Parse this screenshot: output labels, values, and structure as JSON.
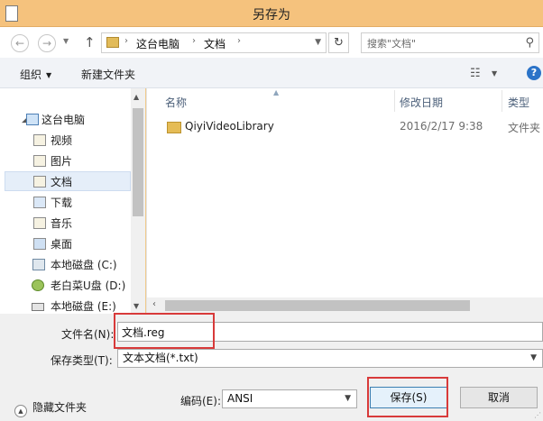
{
  "window": {
    "title": "另存为"
  },
  "address": {
    "crumbs": [
      "这台电脑",
      "文档"
    ],
    "search_placeholder": "搜索\"文档\""
  },
  "toolbar": {
    "organize_label": "组织",
    "new_folder_label": "新建文件夹"
  },
  "nav": {
    "items": [
      {
        "label": "这台电脑",
        "icon": "computer-icon"
      },
      {
        "label": "视频",
        "icon": "video-folder-icon"
      },
      {
        "label": "图片",
        "icon": "pictures-folder-icon"
      },
      {
        "label": "文档",
        "icon": "documents-folder-icon",
        "selected": true
      },
      {
        "label": "下载",
        "icon": "downloads-folder-icon"
      },
      {
        "label": "音乐",
        "icon": "music-folder-icon"
      },
      {
        "label": "桌面",
        "icon": "desktop-folder-icon"
      },
      {
        "label": "本地磁盘 (C:)",
        "icon": "drive-icon"
      },
      {
        "label": "老白菜U盘 (D:)",
        "icon": "usb-drive-icon"
      },
      {
        "label": "本地磁盘 (E:)",
        "icon": "drive-icon"
      }
    ]
  },
  "file_list": {
    "columns": [
      "名称",
      "修改日期",
      "类型"
    ],
    "rows": [
      {
        "name": "QiyiVideoLibrary",
        "date": "2016/2/17 9:38",
        "type": "文件夹"
      }
    ]
  },
  "form": {
    "filename_label": "文件名(N):",
    "filename_value": "文档.reg",
    "filetype_label": "保存类型(T):",
    "filetype_value": "文本文档(*.txt)",
    "encoding_label": "编码(E):",
    "encoding_value": "ANSI",
    "save_label": "保存(S)",
    "cancel_label": "取消",
    "hide_folders_label": "隐藏文件夹"
  },
  "colors": {
    "highlight_box": "#d83a3a",
    "titlebar": "#f5c27d"
  }
}
